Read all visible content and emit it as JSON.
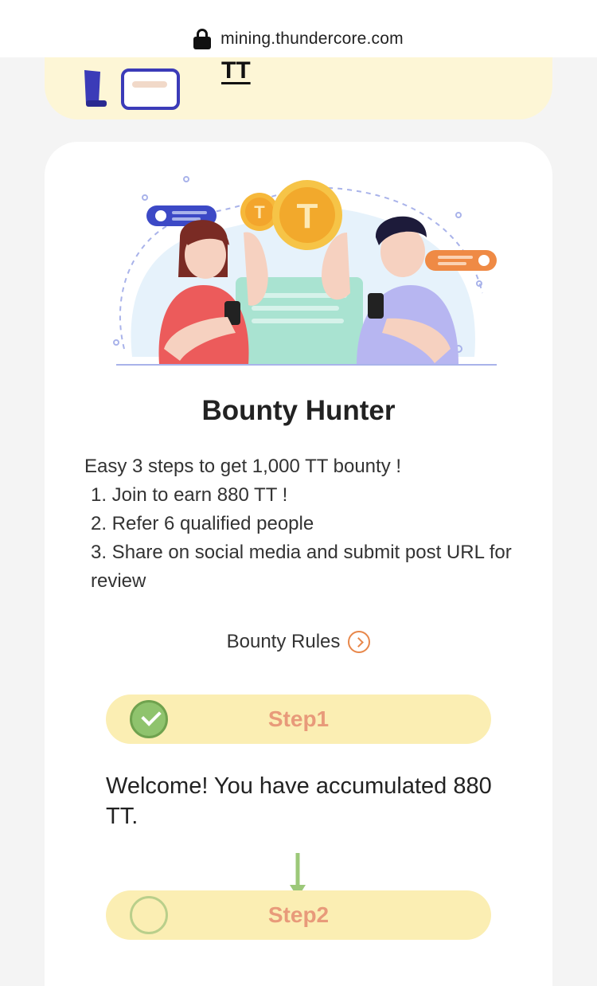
{
  "browser": {
    "url": "mining.thundercore.com"
  },
  "top_card": {
    "label": "TT"
  },
  "bounty": {
    "title": "Bounty Hunter",
    "intro": "Easy 3 steps to get 1,000 TT bounty !",
    "steps": [
      "1. Join to earn 880 TT !",
      "2. Refer 6 qualified people",
      "3. Share on social media and submit post URL for review"
    ],
    "rules_label": "Bounty Rules"
  },
  "step1": {
    "label": "Step1",
    "status": "completed"
  },
  "welcome_message": "Welcome! You have accumulated 880 TT.",
  "step2": {
    "label": "Step2",
    "status": "pending"
  },
  "colors": {
    "accent_orange": "#e8874a",
    "step_pill": "#fbeeb3",
    "check_green": "#8fc36d"
  }
}
